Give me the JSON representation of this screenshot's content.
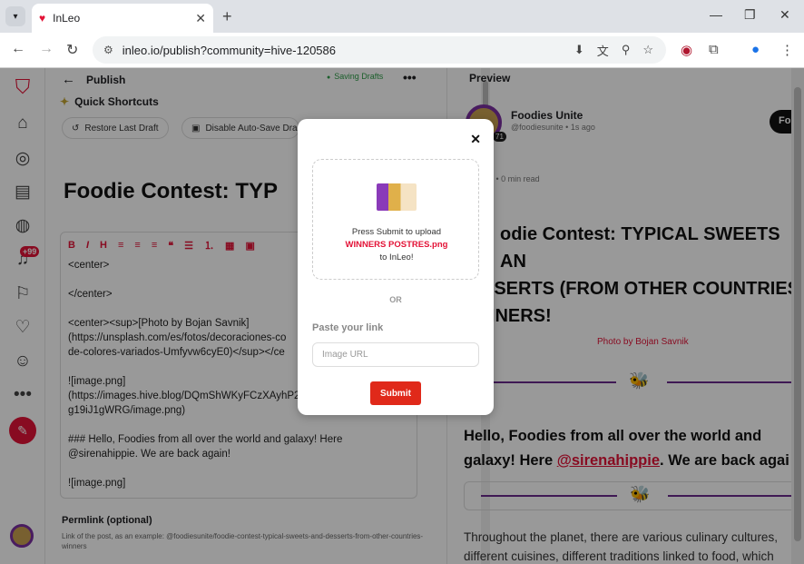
{
  "browser": {
    "tab_title": "InLeo",
    "url": "inleo.io/publish?community=hive-120586"
  },
  "sidebar": {
    "notification_count": "+99"
  },
  "editor": {
    "header": "Publish",
    "saving_status": "Saving Drafts",
    "quick_shortcuts": "Quick Shortcuts",
    "restore_draft": "Restore Last Draft",
    "disable_autosave": "Disable Auto-Save Dra",
    "post_title": "Foodie Contest:  TYP",
    "body_lines": [
      "<center>",
      "",
      "</center>",
      "",
      "<center><sup>[Photo by Bojan Savnik]",
      "(https://unsplash.com/es/fotos/decoraciones-co",
      "de-colores-variados-Umfyvw6cyE0)</sup></ce",
      "",
      "![image.png]",
      "(https://images.hive.blog/DQmShWKyFCzXAyhP2",
      "g19iJ1gWRG/image.png)",
      "",
      "### Hello, Foodies from all over the world and galaxy! Here",
      "@sirenahippie. We are back again!",
      "",
      "![image.png]"
    ],
    "permlink_label": "Permlink (optional)",
    "permlink_help": "Link of the post, as an example: @foodiesunite/foodie-contest-typical-sweets-and-desserts-from-other-countries-winners"
  },
  "preview": {
    "header": "Preview",
    "author_name": "Foodies Unite",
    "author_meta": "@foodiesunite • 1s ago",
    "reputation": "71",
    "follow_label": "Fo",
    "stats": "ws  •  0 min read",
    "title": "odie Contest: TYPICAL SWEETS AND ESSERTS (FROM OTHER COUNTRIES) NNERS!",
    "title_lines": [
      "odie Contest: TYPICAL SWEETS AN",
      "SSERTS (FROM OTHER COUNTRIES",
      "NNERS!"
    ],
    "photo_caption": "Photo by Bojan Savnik",
    "hello_line1": "Hello, Foodies from all over the world and",
    "hello_line2_pre": "galaxy! Here ",
    "hello_mention": "@sirenahippie",
    "hello_line2_post": ". We are back agai",
    "body_line1": "Throughout the planet, there are various culinary cultures,",
    "body_line2": "different cuisines, different traditions linked to food, which"
  },
  "modal": {
    "upload_prompt": "Press Submit to upload",
    "file_name": "WINNERS POSTRES.png",
    "upload_target": "to InLeo!",
    "or_label": "OR",
    "paste_label": "Paste your link",
    "url_placeholder": "Image URL",
    "url_value": "",
    "submit_label": "Submit"
  },
  "colors": {
    "brand": "#e31337",
    "accent_purple": "#6a2a8c",
    "submit": "#e0291a"
  }
}
